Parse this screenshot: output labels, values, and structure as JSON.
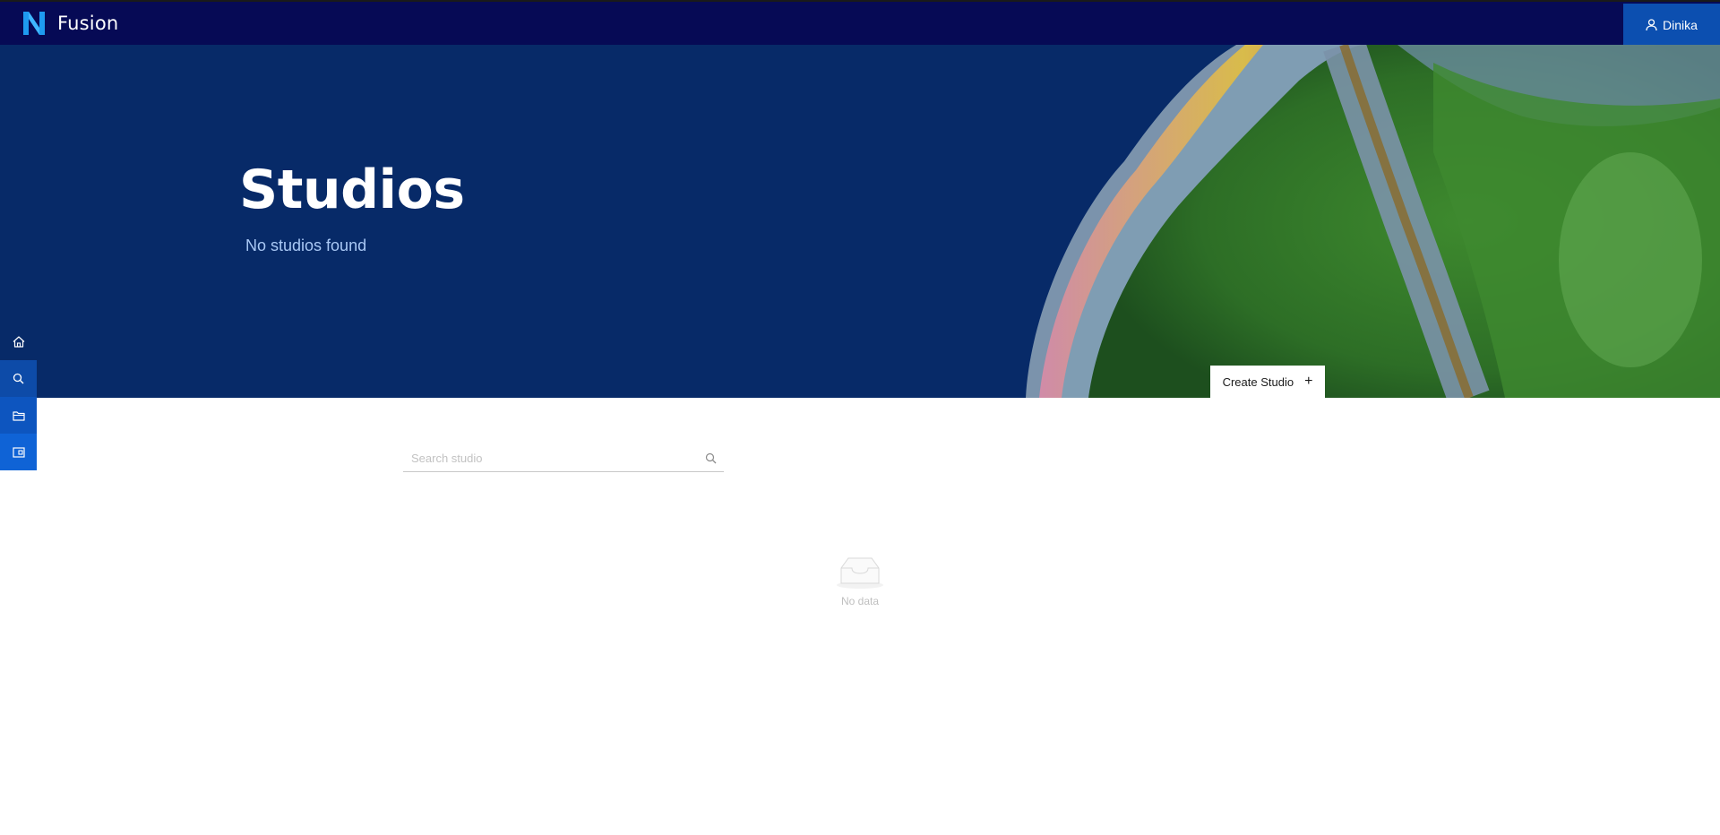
{
  "app": {
    "name": "Fusion",
    "logo_letter": "N",
    "logo_color": "#1e9bf0"
  },
  "user": {
    "name": "Dinika",
    "icon": "user-icon"
  },
  "hero": {
    "title": "Studios",
    "subtitle": "No studios found",
    "create_label": "Create Studio",
    "create_icon": "plus-icon"
  },
  "sidenav": {
    "items": [
      {
        "icon": "home-icon"
      },
      {
        "icon": "search-icon"
      },
      {
        "icon": "folder-icon"
      },
      {
        "icon": "wallet-icon"
      }
    ]
  },
  "search": {
    "placeholder": "Search studio",
    "icon": "search-icon"
  },
  "empty": {
    "text": "No data",
    "icon": "inbox-icon"
  },
  "colors": {
    "topbar": "#060a55",
    "hero_bg": "#072a68",
    "accent": "#0c4fb0"
  }
}
